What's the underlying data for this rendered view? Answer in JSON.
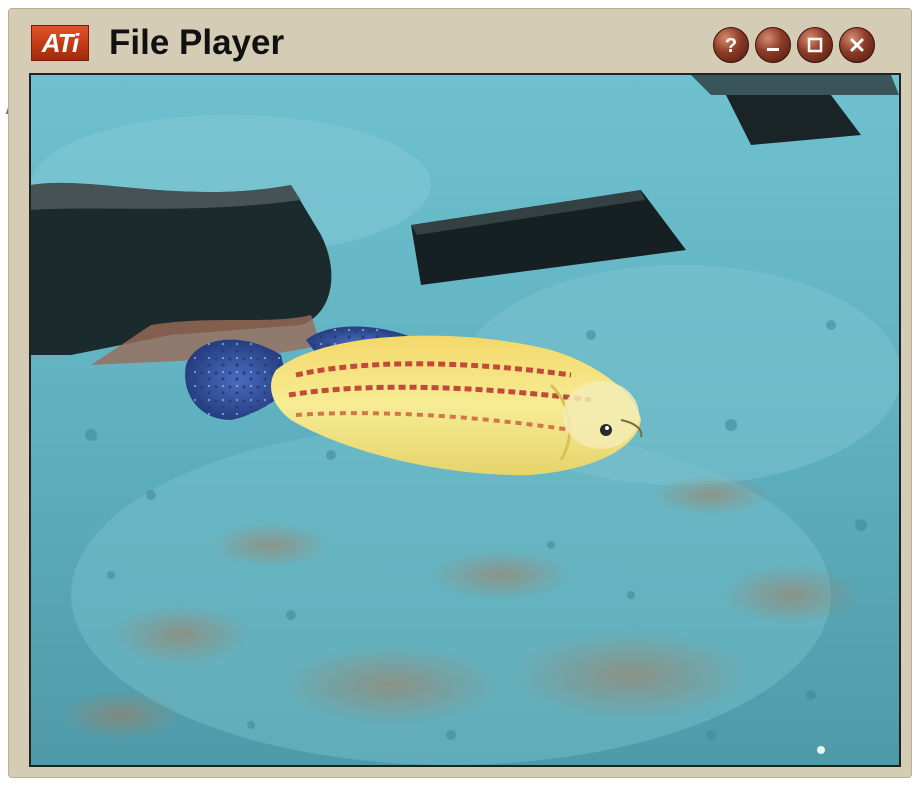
{
  "window": {
    "title": "File Player",
    "logo_text": "ATi"
  },
  "title_buttons": [
    {
      "name": "help-button",
      "icon": "question-icon"
    },
    {
      "name": "minimize-button",
      "icon": "minimize-icon"
    },
    {
      "name": "maximize-button",
      "icon": "maximize-icon"
    },
    {
      "name": "close-button",
      "icon": "close-icon"
    }
  ],
  "video": {
    "description_icon": "video-frame",
    "colors": {
      "water": "#5fb4c4",
      "fish_body": "#f2e27a",
      "fish_fin": "#3a58a8"
    }
  }
}
